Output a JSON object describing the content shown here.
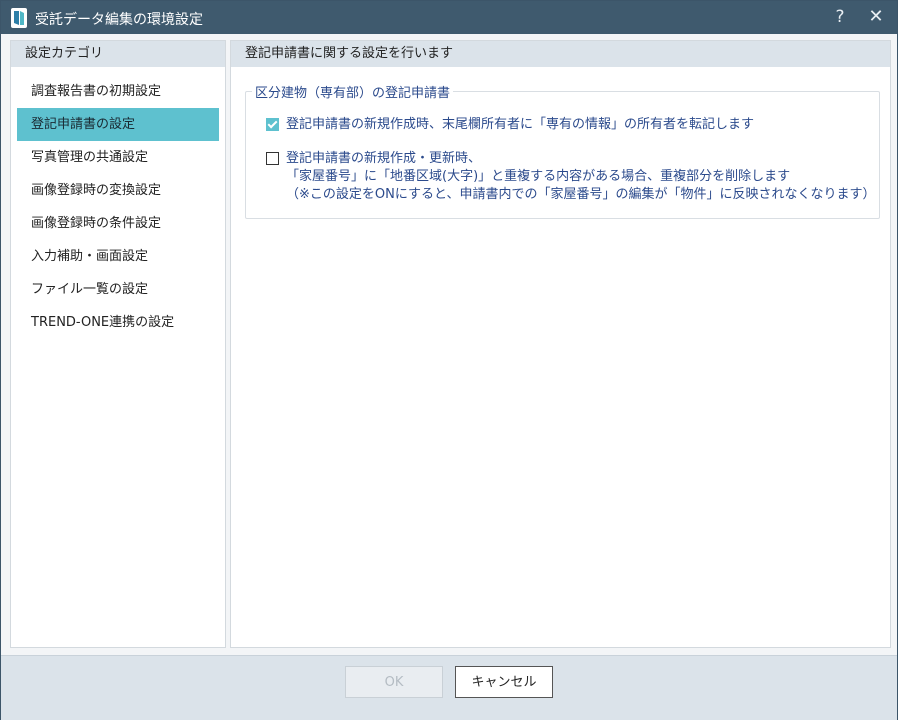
{
  "window": {
    "title": "受託データ編集の環境設定",
    "help_label": "?",
    "close_label": "✕",
    "colors": {
      "titlebar": "#3f5a6e",
      "accent": "#5ec1cf",
      "option_text": "#2b4a8c"
    }
  },
  "sidebar": {
    "header": "設定カテゴリ",
    "selected_index": 1,
    "items": [
      {
        "label": "調査報告書の初期設定"
      },
      {
        "label": "登記申請書の設定"
      },
      {
        "label": "写真管理の共通設定"
      },
      {
        "label": "画像登録時の変換設定"
      },
      {
        "label": "画像登録時の条件設定"
      },
      {
        "label": "入力補助・画面設定"
      },
      {
        "label": "ファイル一覧の設定"
      },
      {
        "label": "TREND-ONE連携の設定"
      }
    ]
  },
  "main": {
    "header": "登記申請書に関する設定を行います",
    "group": {
      "legend": "区分建物（専有部）の登記申請書",
      "options": [
        {
          "checked": true,
          "lines": [
            "登記申請書の新規作成時、末尾欄所有者に「専有の情報」の所有者を転記します"
          ]
        },
        {
          "checked": false,
          "lines": [
            "登記申請書の新規作成・更新時、",
            "「家屋番号」に「地番区域(大字)」と重複する内容がある場合、重複部分を削除します",
            "（※この設定をONにすると、申請書内での「家屋番号」の編集が「物件」に反映されなくなります）"
          ]
        }
      ]
    }
  },
  "footer": {
    "ok_label": "OK",
    "ok_enabled": false,
    "cancel_label": "キャンセル"
  }
}
